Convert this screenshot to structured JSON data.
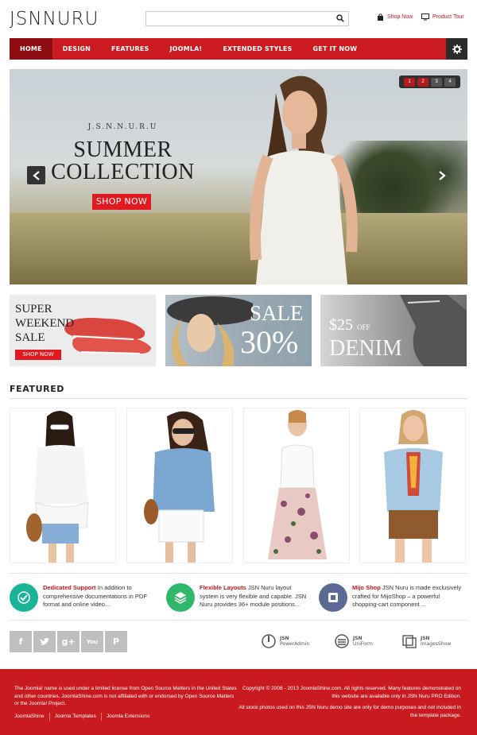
{
  "header": {
    "logo": "JSNNURU",
    "search": {
      "value": "",
      "placeholder": ""
    },
    "shop_now": "Shop Now",
    "product_tour": "Product Tour"
  },
  "nav": {
    "items": [
      {
        "label": "HOME",
        "active": true
      },
      {
        "label": "DESIGN",
        "active": false
      },
      {
        "label": "FEATURES",
        "active": false
      },
      {
        "label": "JOOMLA!",
        "active": false
      },
      {
        "label": "EXTENDED STYLES",
        "active": false
      },
      {
        "label": "GET IT NOW",
        "active": false
      }
    ],
    "accent": "#cc1b20"
  },
  "hero": {
    "kicker": "J.S.N.N.U.R.U",
    "title_line1": "SUMMER",
    "title_line2": "COLLECTION",
    "button": "SHOP NOW",
    "pager": [
      "1",
      "2",
      "3",
      "4"
    ],
    "active_page": "1"
  },
  "banners": [
    {
      "line1": "SUPER",
      "line2": "WEEKEND",
      "line3": "SALE",
      "button": "SHOP NOW"
    },
    {
      "line1": "SALE",
      "line2": "30%"
    },
    {
      "line1": "$25",
      "line1_suffix": "OFF",
      "line2": "DENIM"
    }
  ],
  "featured": {
    "title": "FEATURED",
    "products": [
      "product-1",
      "product-2",
      "product-3",
      "product-4"
    ]
  },
  "features": [
    {
      "title": "Dedicated Support",
      "text": " In addition to comprehensive documentations in PDF format and online video...",
      "icon": "check-icon",
      "color": "#1bb39a"
    },
    {
      "title": "Flexible Layouts",
      "text": " JSN Nuru layout system is very flexible and capable. JSN Nuru provides 36+ module positions...",
      "icon": "layers-icon",
      "color": "#2fb86a"
    },
    {
      "title": "Mijo Shop",
      "text": " JSN Nuru is made exclusively crafted for MijoShop – a powerful shopping-cart component ...",
      "icon": "cart-icon",
      "color": "#5a6a95"
    }
  ],
  "social": [
    "f",
    "t",
    "g+",
    "You",
    "P"
  ],
  "partners": [
    {
      "top": "JSN",
      "name": "PowerAdmin"
    },
    {
      "top": "JSN",
      "name": "UniForm"
    },
    {
      "top": "JSN",
      "name": "ImagesShow"
    }
  ],
  "footer": {
    "left_text": "The Joomla! name is used under a limited license from Open Source Matters in the United States and other countries. JoomlaShine.com is not affiliated with or endorsed by Open Source Matters or the Joomla! Project.",
    "links": [
      "JoomlaShine",
      "Joomla Templates",
      "Joomla Extensions"
    ],
    "right_text1": "Copyright © 2008 - 2013 JoomlaShine.com. All rights reserved. Many features demonstrated on this website are available only in JSN Nuru PRO Edition.",
    "right_text2": "All stock photos used on this JSN Nuru demo site are only for demo purposes and not included in the template package."
  }
}
